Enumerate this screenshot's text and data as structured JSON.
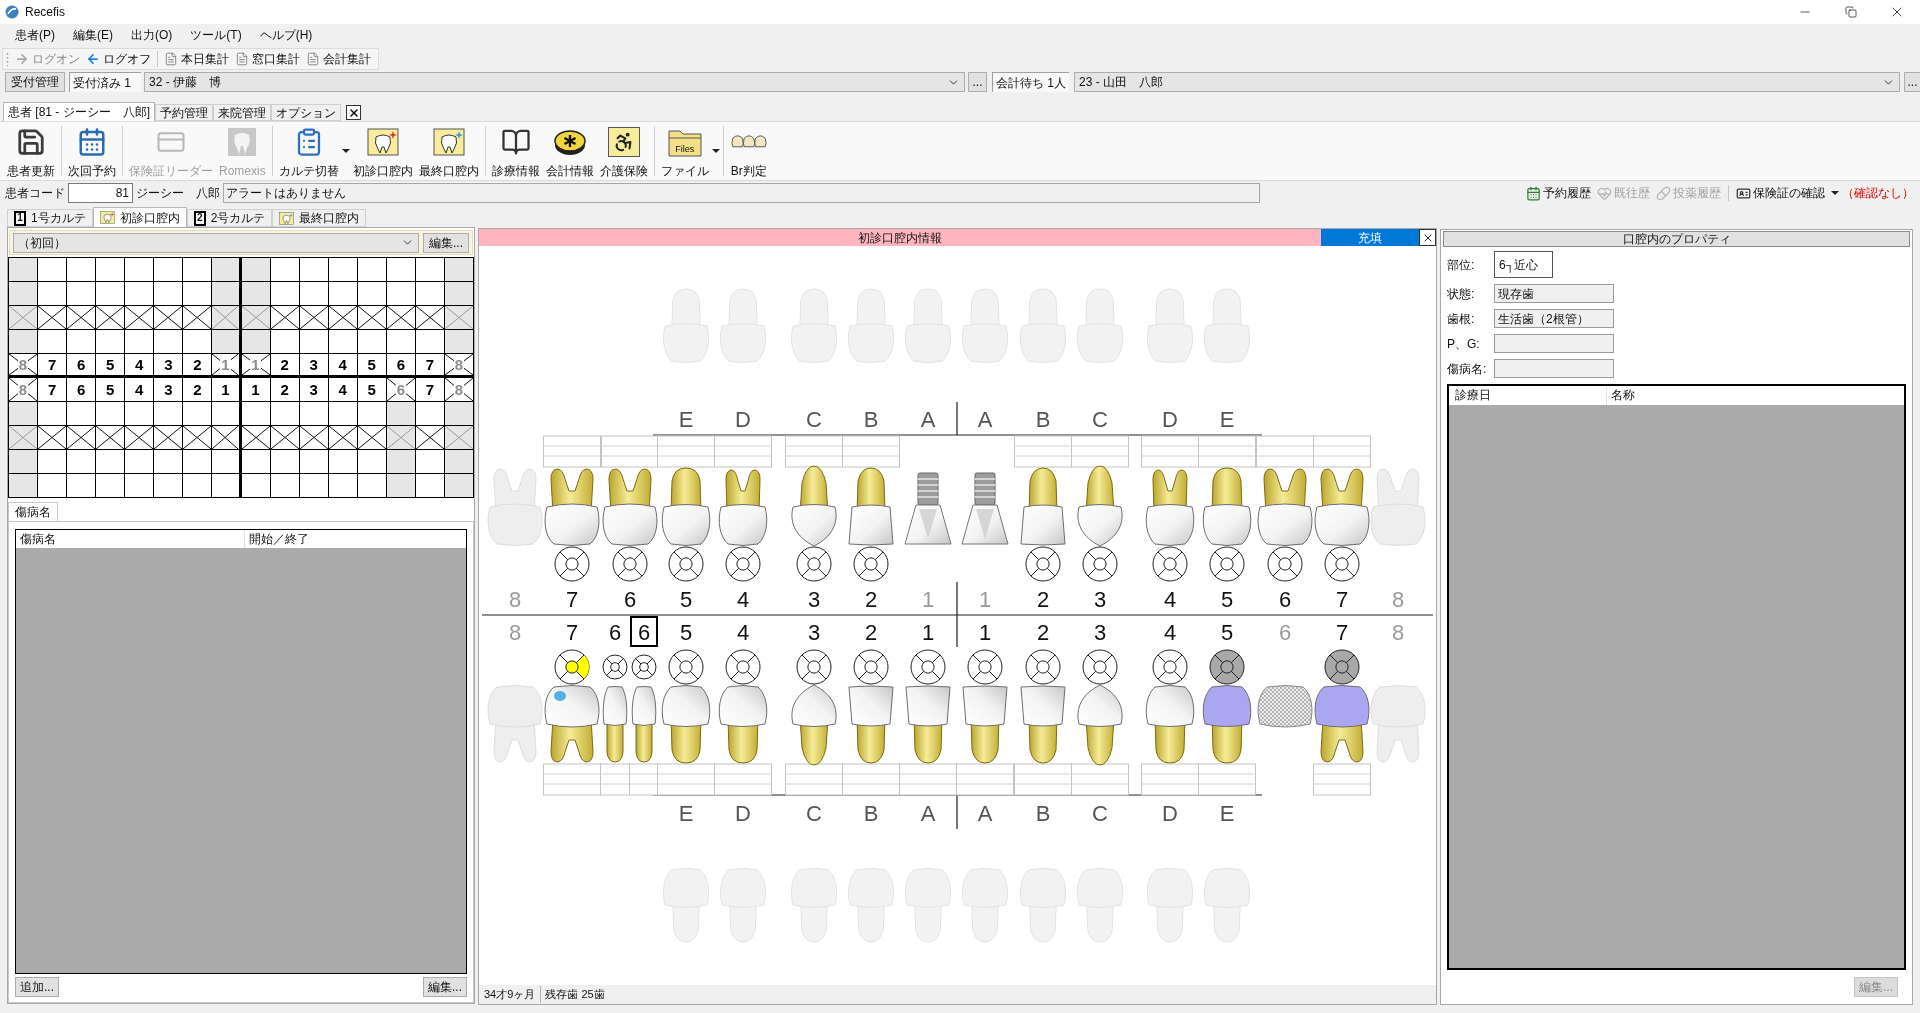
{
  "window": {
    "title": "Recefis"
  },
  "menu": [
    "患者(P)",
    "編集(E)",
    "出力(O)",
    "ツール(T)",
    "ヘルプ(H)"
  ],
  "toolbar": [
    {
      "label": "ログオン",
      "kind": "logon",
      "disabled": true
    },
    {
      "label": "ログオフ",
      "kind": "logoff",
      "disabled": false
    },
    {
      "label": "本日集計",
      "kind": "report",
      "disabled": false
    },
    {
      "label": "窓口集計",
      "kind": "report",
      "disabled": false
    },
    {
      "label": "会計集計",
      "kind": "report",
      "disabled": false
    }
  ],
  "reception": {
    "manage_button": "受付管理",
    "accepted": "受付済み 1",
    "accepted_patient": "32 - 伊藤　博",
    "accepted_more": "...",
    "waiting": "会計待ち 1人",
    "waiting_patient": "23 - 山田　八郎",
    "waiting_more": "..."
  },
  "main_tabs": [
    {
      "label": "患者 [81 - ジーシー　八郎]",
      "selected": true
    },
    {
      "label": "予約管理",
      "selected": false
    },
    {
      "label": "来院管理",
      "selected": false
    },
    {
      "label": "オプション",
      "selected": false
    }
  ],
  "actions": [
    {
      "label": "患者更新",
      "kind": "save",
      "disabled": false,
      "dropdown": false
    },
    {
      "label": "次回予約",
      "kind": "appointment",
      "disabled": false,
      "dropdown": false
    },
    {
      "label": "保険証リーダー",
      "kind": "reader",
      "disabled": true,
      "dropdown": false
    },
    {
      "label": "Romexis",
      "kind": "xray",
      "disabled": true,
      "dropdown": false
    },
    {
      "label": "カルテ切替",
      "kind": "switch",
      "disabled": false,
      "dropdown": true
    },
    {
      "label": "初診口腔内",
      "kind": "first_oral",
      "disabled": false,
      "dropdown": false
    },
    {
      "label": "最終口腔内",
      "kind": "last_oral",
      "disabled": false,
      "dropdown": false
    },
    {
      "label": "診療情報",
      "kind": "records",
      "disabled": false,
      "dropdown": false
    },
    {
      "label": "会計情報",
      "kind": "billing",
      "disabled": false,
      "dropdown": false
    },
    {
      "label": "介護保険",
      "kind": "care",
      "disabled": false,
      "dropdown": false
    },
    {
      "label": "ファイル",
      "kind": "files",
      "badge": "Files",
      "disabled": false,
      "dropdown": true
    },
    {
      "label": "Br判定",
      "kind": "bridge",
      "disabled": false,
      "dropdown": false
    }
  ],
  "patient_bar": {
    "code_label": "患者コード",
    "code": "81",
    "name": "ジーシー　八郎",
    "alert": "アラートはありません",
    "links": [
      {
        "label": "予約履歴",
        "kind": "appointments",
        "disabled": false,
        "dropdown": false
      },
      {
        "label": "既往歴",
        "kind": "history",
        "disabled": true,
        "dropdown": false
      },
      {
        "label": "投薬履歴",
        "kind": "medication",
        "disabled": true,
        "dropdown": false
      },
      {
        "label": "保険証の確認",
        "kind": "insurance",
        "disabled": false,
        "dropdown": true
      }
    ],
    "insurance_status": "（確認なし）"
  },
  "sub_tabs": [
    {
      "label": "1号カルテ",
      "kind": "karte",
      "badge": "1",
      "selected": false
    },
    {
      "label": "初診口腔内",
      "kind": "first_oral",
      "selected": true
    },
    {
      "label": "2号カルテ",
      "kind": "karte",
      "badge": "2",
      "selected": false
    },
    {
      "label": "最終口腔内",
      "kind": "last_oral",
      "selected": false
    }
  ],
  "left_panel": {
    "period": "（初回）",
    "edit_button": "編集...",
    "grid": {
      "upper_rows": [
        {
          "crossed": false
        },
        {
          "crossed": false
        },
        {
          "crossed": true
        },
        {
          "crossed": false
        }
      ],
      "upper": [
        {
          "label": "8",
          "present": false
        },
        {
          "label": "7",
          "present": true
        },
        {
          "label": "6",
          "present": true
        },
        {
          "label": "5",
          "present": true
        },
        {
          "label": "4",
          "present": true
        },
        {
          "label": "3",
          "present": true
        },
        {
          "label": "2",
          "present": true
        },
        {
          "label": "1",
          "present": false
        },
        {
          "label": "1",
          "present": false
        },
        {
          "label": "2",
          "present": true
        },
        {
          "label": "3",
          "present": true
        },
        {
          "label": "4",
          "present": true
        },
        {
          "label": "5",
          "present": true
        },
        {
          "label": "6",
          "present": true
        },
        {
          "label": "7",
          "present": true
        },
        {
          "label": "8",
          "present": false
        }
      ],
      "lower": [
        {
          "label": "8",
          "present": false
        },
        {
          "label": "7",
          "present": true
        },
        {
          "label": "6",
          "present": true
        },
        {
          "label": "5",
          "present": true
        },
        {
          "label": "4",
          "present": true
        },
        {
          "label": "3",
          "present": true
        },
        {
          "label": "2",
          "present": true
        },
        {
          "label": "1",
          "present": true
        },
        {
          "label": "1",
          "present": true
        },
        {
          "label": "2",
          "present": true
        },
        {
          "label": "3",
          "present": true
        },
        {
          "label": "4",
          "present": true
        },
        {
          "label": "5",
          "present": true
        },
        {
          "label": "6",
          "present": false
        },
        {
          "label": "7",
          "present": true
        },
        {
          "label": "8",
          "present": false
        }
      ],
      "lower_rows": [
        {
          "crossed": false
        },
        {
          "crossed": true
        },
        {
          "crossed": false
        },
        {
          "crossed": false
        }
      ]
    },
    "disease_tab": "傷病名",
    "columns": [
      "傷病名",
      "開始／終了"
    ],
    "buttons": [
      {
        "label": "追加...",
        "disabled": false
      },
      {
        "label": "編集...",
        "disabled": false
      }
    ]
  },
  "chart": {
    "title": "初診口腔内情報",
    "mode": "充填",
    "upper_primary": [
      "E",
      "D",
      "C",
      "B",
      "A",
      "A",
      "B",
      "C",
      "D",
      "E"
    ],
    "upper": [
      {
        "number": "8",
        "kind": "missing",
        "selected": false
      },
      {
        "number": "7",
        "kind": "molar",
        "crowned": false,
        "filled": false,
        "selected": false
      },
      {
        "number": "6",
        "kind": "molar",
        "crowned": false,
        "filled": false,
        "selected": false
      },
      {
        "number": "5",
        "kind": "premolar",
        "crowned": false,
        "filled": false,
        "selected": false
      },
      {
        "number": "4",
        "kind": "bicuspid",
        "crowned": false,
        "filled": false,
        "selected": false
      },
      {
        "number": "3",
        "kind": "canine",
        "crowned": false,
        "filled": false,
        "selected": false
      },
      {
        "number": "2",
        "kind": "incisor",
        "crowned": false,
        "filled": false,
        "selected": false
      },
      {
        "number": "1",
        "kind": "implant",
        "crowned": false,
        "filled": false,
        "selected": false
      },
      {
        "number": "1",
        "kind": "implant",
        "crowned": false,
        "filled": false,
        "selected": false
      },
      {
        "number": "2",
        "kind": "incisor",
        "crowned": false,
        "filled": false,
        "selected": false
      },
      {
        "number": "3",
        "kind": "canine",
        "crowned": false,
        "filled": false,
        "selected": false
      },
      {
        "number": "4",
        "kind": "bicuspid",
        "crowned": false,
        "filled": false,
        "selected": false
      },
      {
        "number": "5",
        "kind": "premolar",
        "crowned": false,
        "filled": false,
        "selected": false
      },
      {
        "number": "6",
        "kind": "molar",
        "crowned": false,
        "filled": false,
        "selected": false
      },
      {
        "number": "7",
        "kind": "molar",
        "crowned": false,
        "filled": false,
        "selected": false
      },
      {
        "number": "8",
        "kind": "missing",
        "selected": false
      }
    ],
    "lower": [
      {
        "number": "8",
        "kind": "missing",
        "selected": false
      },
      {
        "number": "7",
        "kind": "molar",
        "crowned": false,
        "filled": true,
        "selected": false
      },
      {
        "number": "6",
        "kind": "split",
        "crowned": false,
        "filled": false,
        "selected": false
      },
      {
        "number": "6",
        "kind": "split",
        "crowned": false,
        "filled": false,
        "selected": true
      },
      {
        "number": "5",
        "kind": "premolar",
        "crowned": false,
        "filled": false,
        "selected": false
      },
      {
        "number": "4",
        "kind": "premolar",
        "crowned": false,
        "filled": false,
        "selected": false
      },
      {
        "number": "3",
        "kind": "canine",
        "crowned": false,
        "filled": false,
        "selected": false
      },
      {
        "number": "2",
        "kind": "incisor",
        "crowned": false,
        "filled": false,
        "selected": false
      },
      {
        "number": "1",
        "kind": "incisor",
        "crowned": false,
        "filled": false,
        "selected": false
      },
      {
        "number": "1",
        "kind": "incisor",
        "crowned": false,
        "filled": false,
        "selected": false
      },
      {
        "number": "2",
        "kind": "incisor",
        "crowned": false,
        "filled": false,
        "selected": false
      },
      {
        "number": "3",
        "kind": "canine",
        "crowned": false,
        "filled": false,
        "selected": false
      },
      {
        "number": "4",
        "kind": "premolar",
        "crowned": false,
        "filled": false,
        "selected": false
      },
      {
        "number": "5",
        "kind": "premolar",
        "crowned": true,
        "filled": false,
        "selected": false
      },
      {
        "number": "6",
        "kind": "pontic",
        "selected": false
      },
      {
        "number": "7",
        "kind": "molar",
        "crowned": true,
        "filled": false,
        "selected": false
      },
      {
        "number": "8",
        "kind": "missing",
        "selected": false
      }
    ],
    "lower_primary": [
      "E",
      "D",
      "C",
      "B",
      "A",
      "A",
      "B",
      "C",
      "D",
      "E"
    ]
  },
  "status_bar": [
    "34才9ヶ月",
    "残存歯 25歯"
  ],
  "properties": {
    "title": "口腔内のプロパティ",
    "fields": [
      {
        "label": "部位:",
        "value": "6┐近心",
        "kind": "box"
      },
      {
        "label": "状態:",
        "value": "現存歯",
        "kind": "text"
      },
      {
        "label": "歯根:",
        "value": "生活歯（2根管）",
        "kind": "text"
      },
      {
        "label": "P、G:",
        "kind": "text"
      },
      {
        "label": "傷病名:",
        "kind": "text"
      }
    ],
    "columns": [
      "診療日",
      "名称"
    ],
    "button": {
      "label": "編集...",
      "disabled": true
    }
  }
}
